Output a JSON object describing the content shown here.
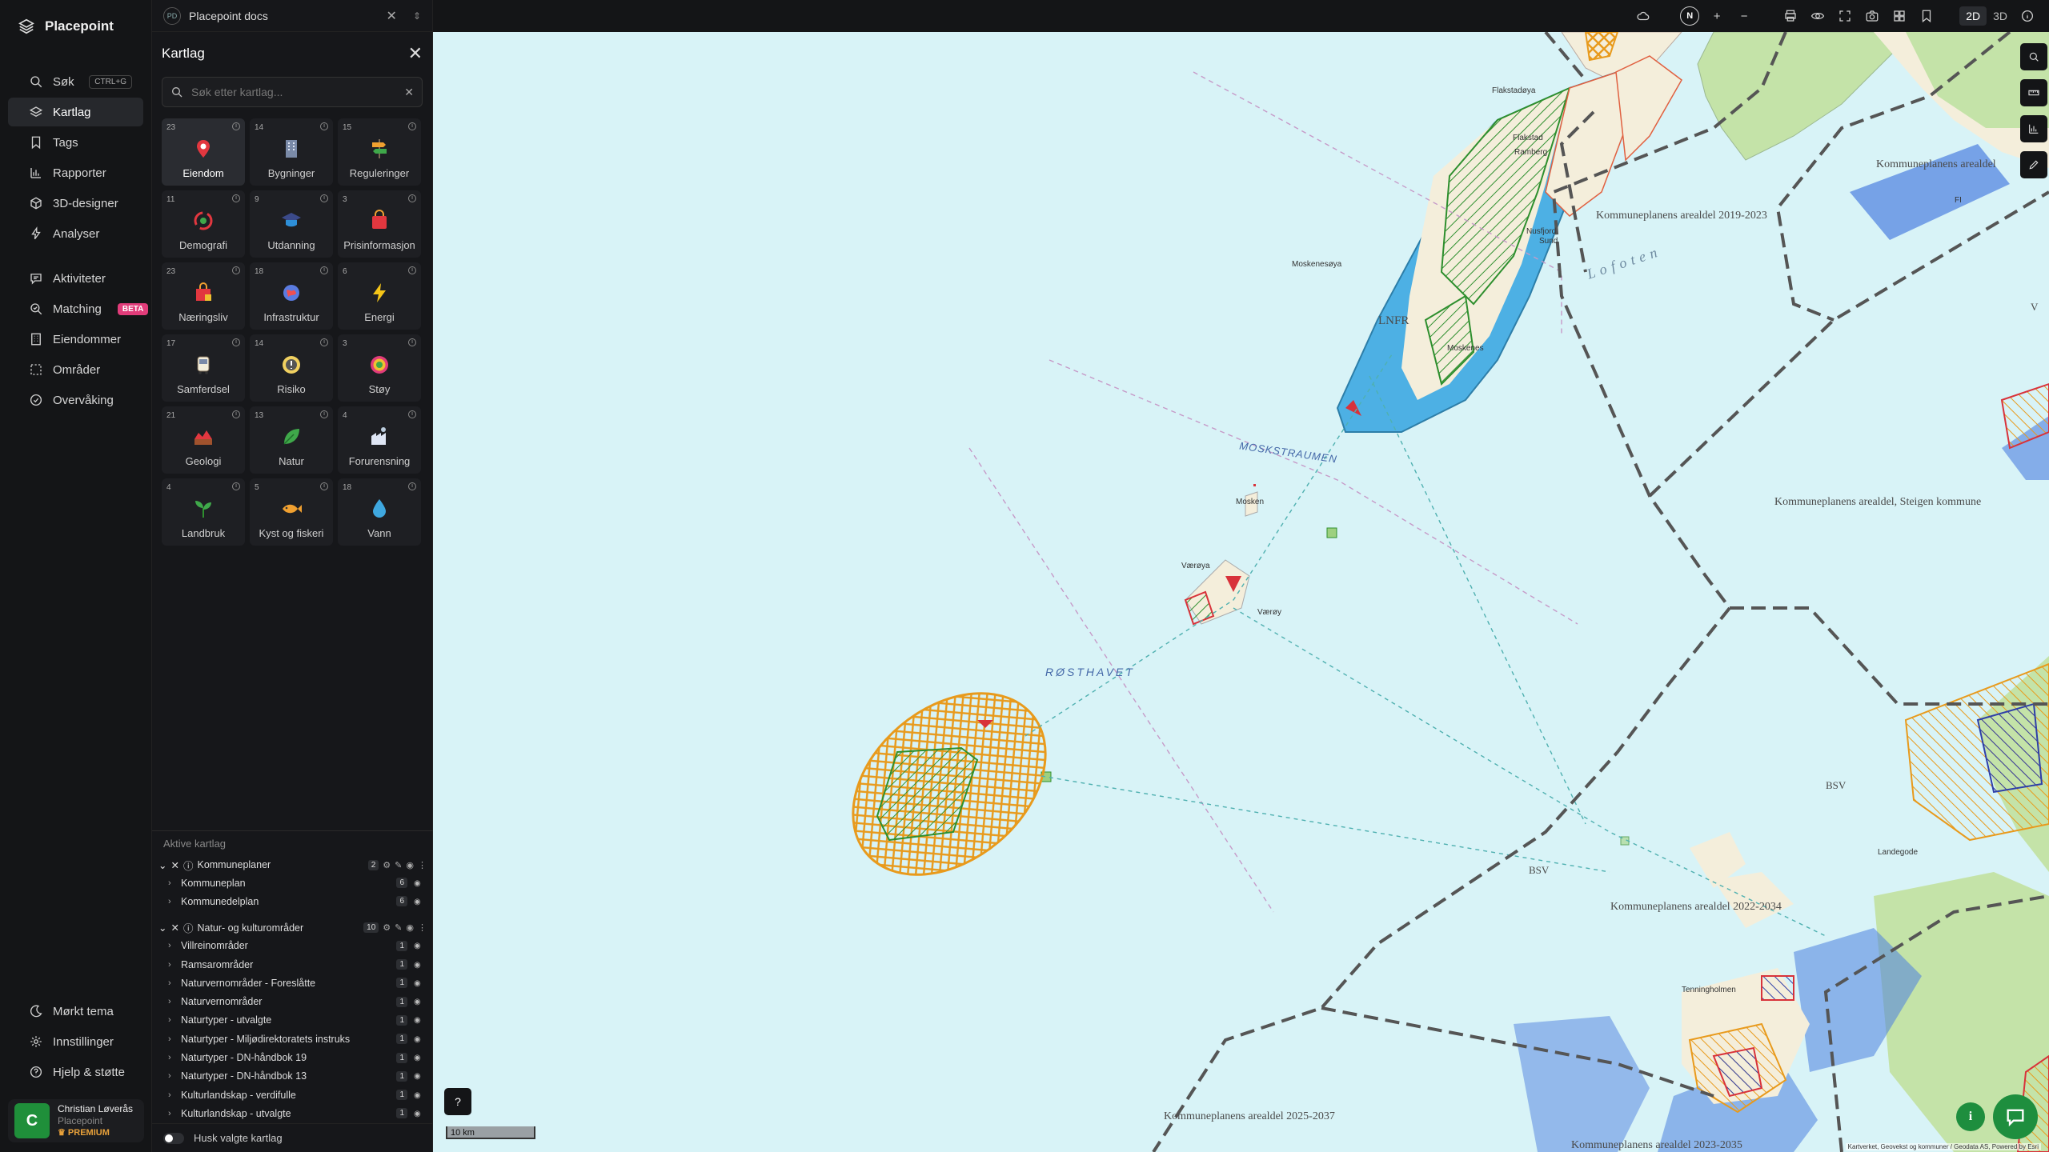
{
  "brand": {
    "name": "Placepoint"
  },
  "nav": {
    "items": [
      {
        "id": "sok",
        "label": "Søk",
        "shortcut": "CTRL+G",
        "icon": "search-icon"
      },
      {
        "id": "kartlag",
        "label": "Kartlag",
        "icon": "layers-icon",
        "active": true
      },
      {
        "id": "tags",
        "label": "Tags",
        "icon": "bookmark-icon"
      },
      {
        "id": "rapporter",
        "label": "Rapporter",
        "icon": "bar-chart-icon"
      },
      {
        "id": "3d",
        "label": "3D-designer",
        "icon": "cube-icon"
      },
      {
        "id": "analyser",
        "label": "Analyser",
        "icon": "bolt-icon"
      },
      {
        "id": "aktiviteter",
        "label": "Aktiviteter",
        "icon": "chat-icon"
      },
      {
        "id": "matching",
        "label": "Matching",
        "badge": "BETA",
        "icon": "match-icon"
      },
      {
        "id": "eiendommer",
        "label": "Eiendommer",
        "icon": "building-icon"
      },
      {
        "id": "omrader",
        "label": "Områder",
        "icon": "area-icon"
      },
      {
        "id": "overvaking",
        "label": "Overvåking",
        "icon": "monitor-icon"
      }
    ],
    "bottom": [
      {
        "id": "theme",
        "label": "Mørkt tema",
        "icon": "moon-icon"
      },
      {
        "id": "settings",
        "label": "Innstillinger",
        "icon": "gear-icon"
      },
      {
        "id": "help",
        "label": "Hjelp & støtte",
        "icon": "help-icon"
      }
    ]
  },
  "user": {
    "initial": "C",
    "name": "Christian Løverås",
    "org": "Placepoint",
    "plan": "PREMIUM"
  },
  "doc_tab": {
    "badge": "PD",
    "title": "Placepoint docs"
  },
  "panel": {
    "title": "Kartlag",
    "search_placeholder": "Søk etter kartlag...",
    "categories": [
      {
        "count": "23",
        "label": "Eiendom",
        "icon": "pin-icon",
        "active": true
      },
      {
        "count": "14",
        "label": "Bygninger",
        "icon": "building-icon"
      },
      {
        "count": "15",
        "label": "Reguleringer",
        "icon": "signpost-icon"
      },
      {
        "count": "11",
        "label": "Demografi",
        "icon": "people-icon"
      },
      {
        "count": "9",
        "label": "Utdanning",
        "icon": "graduation-icon"
      },
      {
        "count": "3",
        "label": "Prisinformasjon",
        "icon": "pricetag-icon"
      },
      {
        "count": "23",
        "label": "Næringsliv",
        "icon": "shop-icon"
      },
      {
        "count": "18",
        "label": "Infrastruktur",
        "icon": "globe-icon"
      },
      {
        "count": "6",
        "label": "Energi",
        "icon": "lightning-icon"
      },
      {
        "count": "17",
        "label": "Samferdsel",
        "icon": "bus-icon"
      },
      {
        "count": "14",
        "label": "Risiko",
        "icon": "warning-icon"
      },
      {
        "count": "3",
        "label": "Støy",
        "icon": "noise-icon"
      },
      {
        "count": "21",
        "label": "Geologi",
        "icon": "geology-icon"
      },
      {
        "count": "13",
        "label": "Natur",
        "icon": "leaf-icon"
      },
      {
        "count": "4",
        "label": "Forurensning",
        "icon": "factory-icon"
      },
      {
        "count": "4",
        "label": "Landbruk",
        "icon": "sprout-icon"
      },
      {
        "count": "5",
        "label": "Kyst og fiskeri",
        "icon": "fish-icon"
      },
      {
        "count": "18",
        "label": "Vann",
        "icon": "water-drop-icon"
      }
    ],
    "active_title": "Aktive kartlag",
    "groups": [
      {
        "name": "Kommuneplaner",
        "count": "2",
        "layers": [
          {
            "name": "Kommuneplan",
            "count": "6"
          },
          {
            "name": "Kommunedelplan",
            "count": "6"
          }
        ]
      },
      {
        "name": "Natur- og kulturområder",
        "count": "10",
        "layers": [
          {
            "name": "Villreinområder",
            "count": "1"
          },
          {
            "name": "Ramsarområder",
            "count": "1"
          },
          {
            "name": "Naturvernområder - Foreslåtte",
            "count": "1"
          },
          {
            "name": "Naturvernområder",
            "count": "1"
          },
          {
            "name": "Naturtyper - utvalgte",
            "count": "1"
          },
          {
            "name": "Naturtyper - Miljødirektoratets instruks",
            "count": "1"
          },
          {
            "name": "Naturtyper - DN-håndbok 19",
            "count": "1"
          },
          {
            "name": "Naturtyper - DN-håndbok 13",
            "count": "1"
          },
          {
            "name": "Kulturlandskap - verdifulle",
            "count": "1"
          },
          {
            "name": "Kulturlandskap - utvalgte",
            "count": "1"
          }
        ]
      }
    ],
    "remember_label": "Husk valgte kartlag"
  },
  "toolbar": {
    "compass": "N",
    "zoom_in": "+",
    "zoom_out": "−",
    "mode_2d": "2D",
    "mode_3d": "3D",
    "active_mode": "2D"
  },
  "map": {
    "labels": {
      "flakstadoya": "Flakstadøya",
      "flakstad": "Flakstad",
      "ramberg": "Ramberg",
      "nusfjord": "Nusfjord",
      "sund": "Sund",
      "moskenesoya": "Moskenesøya",
      "moskenes": "Moskenes",
      "lnfr": "LNFR",
      "lofoten": "Lofoten",
      "moskstraumen": "MOSKSTRAUMEN",
      "mosken": "Mosken",
      "vaeroya": "Værøya",
      "vaeroy": "Værøy",
      "rosthavet": "RØSTHAVET",
      "kp_2019": "Kommuneplanens arealdel 2019-2023",
      "kp_steigen": "Kommuneplanens arealdel, Steigen kommune",
      "kp_2022": "Kommuneplanens arealdel 2022-2034",
      "kp_2025": "Kommuneplanens arealdel 2025-2037",
      "kp_2023": "Kommuneplanens arealdel 2023-2035",
      "kp_top": "Kommuneplanens arealdel",
      "bsv1": "BSV",
      "bsv2": "BSV",
      "fi": "FI",
      "v": "V",
      "landegode": "Landegode",
      "tenningholmen": "Tenningholmen"
    },
    "scale": "10 km",
    "attribution": "Kartverket, Geovekst og kommuner / Geodata AS, Powered by Esri"
  },
  "colors": {
    "accent": "#1e8e3e",
    "sea": "#d8f3f7",
    "land": "#f4eedb",
    "forest": "#c4e3a8",
    "protected": "#4db0e4",
    "hatch_orange": "#e89a1c",
    "boundary": "#555555",
    "beta": "#e23c7a"
  }
}
